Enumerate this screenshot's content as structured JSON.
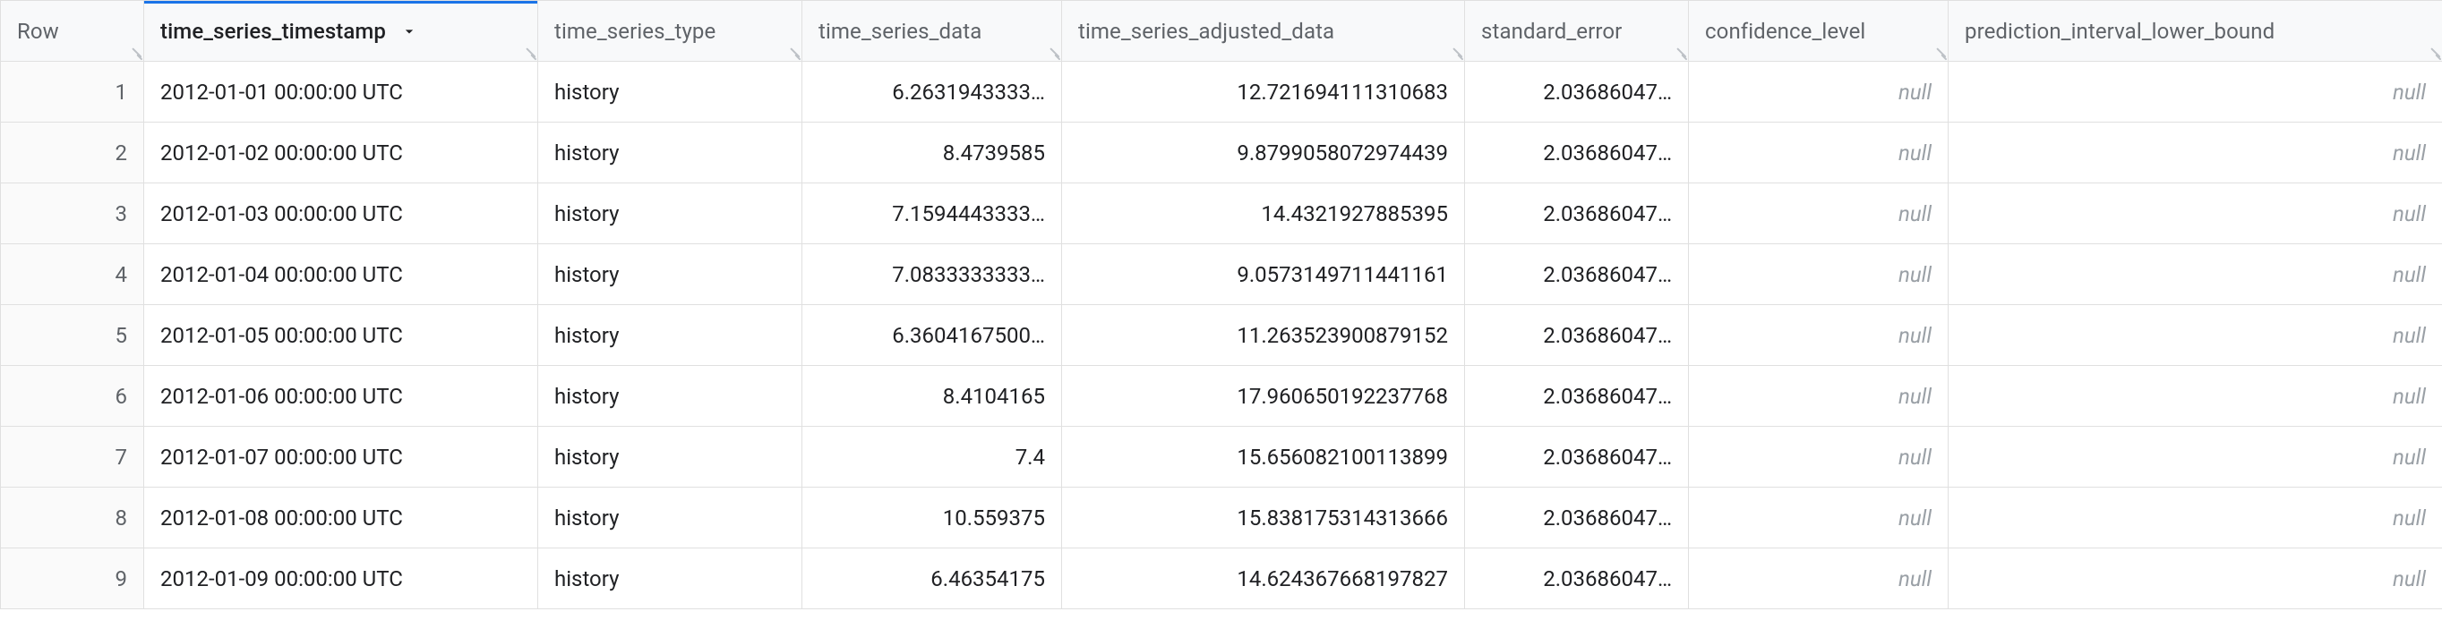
{
  "columns": [
    {
      "key": "row",
      "label": "Row",
      "sorted": false
    },
    {
      "key": "time_series_timestamp",
      "label": "time_series_timestamp",
      "sorted": true,
      "sort_dir": "desc"
    },
    {
      "key": "time_series_type",
      "label": "time_series_type",
      "sorted": false
    },
    {
      "key": "time_series_data",
      "label": "time_series_data",
      "sorted": false
    },
    {
      "key": "time_series_adjusted_data",
      "label": "time_series_adjusted_data",
      "sorted": false
    },
    {
      "key": "standard_error",
      "label": "standard_error",
      "sorted": false
    },
    {
      "key": "confidence_level",
      "label": "confidence_level",
      "sorted": false
    },
    {
      "key": "prediction_interval_lower_bound",
      "label": "prediction_interval_lower_bound",
      "sorted": false
    }
  ],
  "null_text": "null",
  "rows": [
    {
      "n": "1",
      "ts": "2012-01-01 00:00:00 UTC",
      "type": "history",
      "data": "6.2631943333…",
      "adj": "12.721694111310683",
      "se": "2.03686047…",
      "cl": null,
      "pil": null
    },
    {
      "n": "2",
      "ts": "2012-01-02 00:00:00 UTC",
      "type": "history",
      "data": "8.4739585",
      "adj": "9.8799058072974439",
      "se": "2.03686047…",
      "cl": null,
      "pil": null
    },
    {
      "n": "3",
      "ts": "2012-01-03 00:00:00 UTC",
      "type": "history",
      "data": "7.1594443333…",
      "adj": "14.4321927885395",
      "se": "2.03686047…",
      "cl": null,
      "pil": null
    },
    {
      "n": "4",
      "ts": "2012-01-04 00:00:00 UTC",
      "type": "history",
      "data": "7.0833333333…",
      "adj": "9.0573149711441161",
      "se": "2.03686047…",
      "cl": null,
      "pil": null
    },
    {
      "n": "5",
      "ts": "2012-01-05 00:00:00 UTC",
      "type": "history",
      "data": "6.3604167500…",
      "adj": "11.263523900879152",
      "se": "2.03686047…",
      "cl": null,
      "pil": null
    },
    {
      "n": "6",
      "ts": "2012-01-06 00:00:00 UTC",
      "type": "history",
      "data": "8.4104165",
      "adj": "17.960650192237768",
      "se": "2.03686047…",
      "cl": null,
      "pil": null
    },
    {
      "n": "7",
      "ts": "2012-01-07 00:00:00 UTC",
      "type": "history",
      "data": "7.4",
      "adj": "15.656082100113899",
      "se": "2.03686047…",
      "cl": null,
      "pil": null
    },
    {
      "n": "8",
      "ts": "2012-01-08 00:00:00 UTC",
      "type": "history",
      "data": "10.559375",
      "adj": "15.838175314313666",
      "se": "2.03686047…",
      "cl": null,
      "pil": null
    },
    {
      "n": "9",
      "ts": "2012-01-09 00:00:00 UTC",
      "type": "history",
      "data": "6.46354175",
      "adj": "14.624367668197827",
      "se": "2.03686047…",
      "cl": null,
      "pil": null
    }
  ]
}
